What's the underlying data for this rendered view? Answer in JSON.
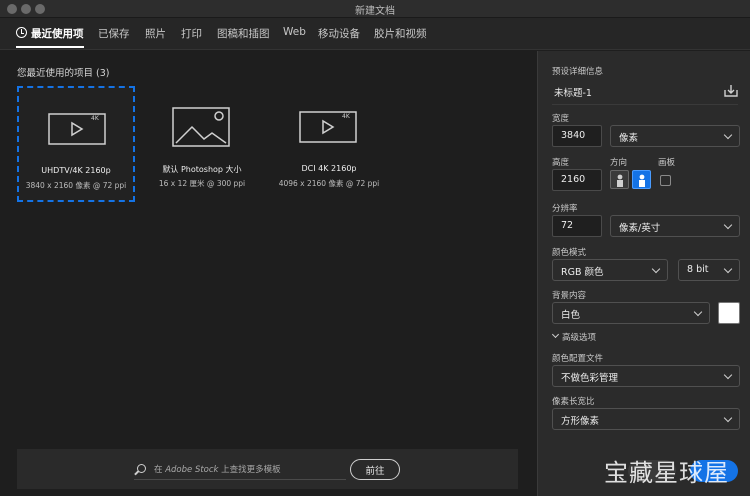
{
  "window": {
    "title": "新建文档"
  },
  "tabs": [
    {
      "label": "最近使用项"
    },
    {
      "label": "已保存"
    },
    {
      "label": "照片"
    },
    {
      "label": "打印"
    },
    {
      "label": "图稿和插图"
    },
    {
      "label": "Web"
    },
    {
      "label": "移动设备"
    },
    {
      "label": "胶片和视频"
    }
  ],
  "recent": {
    "title": "您最近使用的项目",
    "count": "(3)",
    "items": [
      {
        "name": "UHDTV/4K 2160p",
        "details": "3840 x 2160 像素 @ 72 ppi",
        "badge": "4K",
        "icon": "video-icon"
      },
      {
        "name": "默认 Photoshop 大小",
        "details": "16 x 12 厘米 @ 300 ppi",
        "icon": "image-icon"
      },
      {
        "name": "DCI 4K 2160p",
        "details": "4096 x 2160 像素 @ 72 ppi",
        "badge": "4K",
        "icon": "video-icon"
      }
    ]
  },
  "stock_search": {
    "prefix": "在 ",
    "brand": "Adobe Stock",
    "suffix": " 上查找更多模板",
    "go_label": "前往"
  },
  "preset": {
    "section_label": "预设详细信息",
    "name": "未标题-1",
    "width_label": "宽度",
    "width_value": "3840",
    "width_unit": "像素",
    "height_label": "高度",
    "height_value": "2160",
    "orientation_label": "方向",
    "artboard_label": "画板",
    "resolution_label": "分辨率",
    "resolution_value": "72",
    "resolution_unit": "像素/英寸",
    "color_mode_label": "颜色模式",
    "color_mode_value": "RGB 颜色",
    "bit_depth_value": "8 bit",
    "background_label": "背景内容",
    "background_value": "白色",
    "background_color": "#ffffff",
    "advanced_label": "高级选项",
    "color_profile_label": "颜色配置文件",
    "color_profile_value": "不做色彩管理",
    "pixel_aspect_label": "像素长宽比",
    "pixel_aspect_value": "方形像素"
  },
  "watermark": "宝藏星球屋",
  "colors": {
    "accent": "#1473e6",
    "background": "#1e1e1e",
    "panel": "#2b2b2b"
  }
}
